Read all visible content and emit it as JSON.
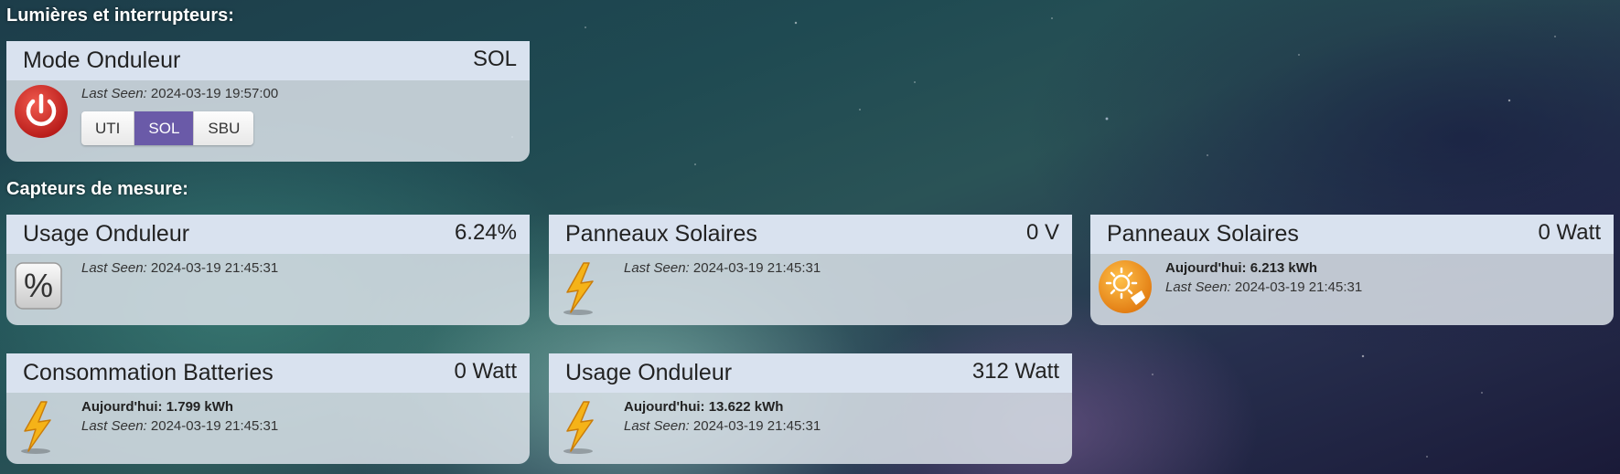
{
  "sections": {
    "switches_title": "Lumières et interrupteurs:",
    "sensors_title": "Capteurs de mesure:"
  },
  "mode_card": {
    "name": "Mode Onduleur",
    "value": "SOL",
    "last_seen_label": "Last Seen:",
    "last_seen": "2024-03-19 19:57:00",
    "icon": "power-icon",
    "buttons": [
      "UTI",
      "SOL",
      "SBU"
    ],
    "selected": "SOL"
  },
  "sensors": [
    {
      "name": "Usage Onduleur",
      "value": "6.24%",
      "icon": "percent-icon",
      "today_label": "",
      "today": "",
      "last_seen_label": "Last Seen:",
      "last_seen": "2024-03-19 21:45:31"
    },
    {
      "name": "Panneaux Solaires",
      "value": "0 V",
      "icon": "lightning-icon",
      "today_label": "",
      "today": "",
      "last_seen_label": "Last Seen:",
      "last_seen": "2024-03-19 21:45:31"
    },
    {
      "name": "Panneaux Solaires",
      "value": "0 Watt",
      "icon": "solar-icon",
      "today_label": "Aujourd'hui:",
      "today": "6.213 kWh",
      "last_seen_label": "Last Seen:",
      "last_seen": "2024-03-19 21:45:31"
    },
    {
      "name": "Consommation Batteries",
      "value": "0 Watt",
      "icon": "lightning-icon",
      "today_label": "Aujourd'hui:",
      "today": "1.799 kWh",
      "last_seen_label": "Last Seen:",
      "last_seen": "2024-03-19 21:45:31"
    },
    {
      "name": "Usage Onduleur",
      "value": "312 Watt",
      "icon": "lightning-icon",
      "today_label": "Aujourd'hui:",
      "today": "13.622 kWh",
      "last_seen_label": "Last Seen:",
      "last_seen": "2024-03-19 21:45:31"
    }
  ],
  "colors": {
    "accent": "#6a5aa8",
    "power_red": "#d8312c",
    "solar_orange": "#f39a1e"
  }
}
